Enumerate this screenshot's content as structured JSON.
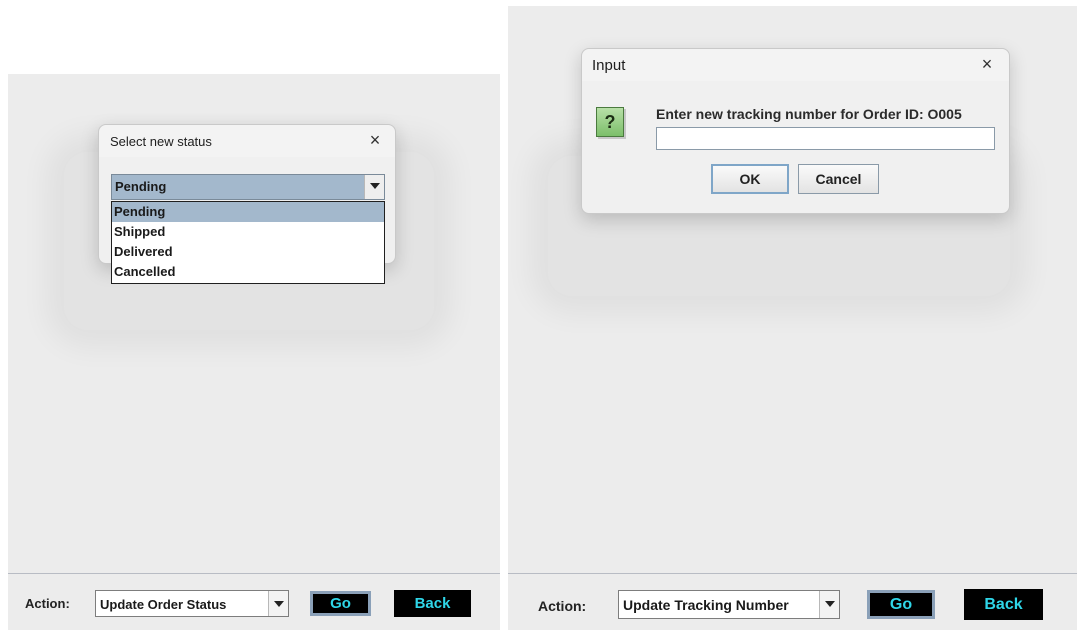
{
  "left": {
    "dialog": {
      "title": "Select new status",
      "close_glyph": "×",
      "combo_value": "Pending",
      "options": [
        "Pending",
        "Shipped",
        "Delivered",
        "Cancelled"
      ],
      "selected_option": "Pending"
    },
    "bottom_bar": {
      "action_label": "Action:",
      "action_value": "Update Order Status",
      "go_label": "Go",
      "back_label": "Back"
    }
  },
  "right": {
    "dialog": {
      "title": "Input",
      "close_glyph": "×",
      "icon_glyph": "?",
      "icon_name": "question-icon",
      "prompt": "Enter new tracking number for Order ID: O005",
      "input_value": "",
      "ok_label": "OK",
      "cancel_label": "Cancel"
    },
    "bottom_bar": {
      "action_label": "Action:",
      "action_value": "Update Tracking Number",
      "go_label": "Go",
      "back_label": "Back"
    }
  },
  "colors": {
    "panel_bg": "#ececec",
    "selection": "#a3b8cc",
    "button_black": "#000000",
    "button_text_cyan": "#2fd6e8",
    "question_icon_green": "#7cbf6a"
  }
}
